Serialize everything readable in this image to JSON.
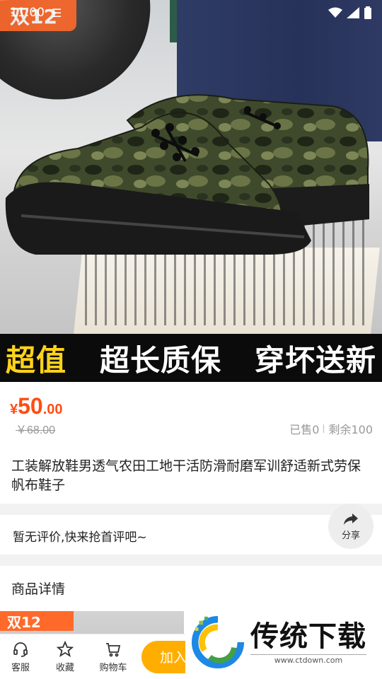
{
  "status_bar": {
    "time": "11:00",
    "menu_icon": "menu-lines-icon",
    "icons": [
      "wifi-icon",
      "signal-icon",
      "battery-icon"
    ]
  },
  "hero": {
    "promo_badge": "双12",
    "banner": {
      "left": "超值",
      "middle": "超长质保",
      "right": "穿坏送新"
    }
  },
  "price": {
    "symbol": "¥",
    "integer": "50",
    "decimal": ".00",
    "original": "￥68.00",
    "sold": "已售0",
    "remaining": "剩余100",
    "accent_color": "#ff4d12"
  },
  "product": {
    "title": "工装解放鞋男透气农田工地干活防滑耐磨军训舒适新式劳保帆布鞋子"
  },
  "review": {
    "empty_text": "暂无评价,快来抢首评吧~"
  },
  "share": {
    "label": "分享",
    "icon": "share-arrow-icon"
  },
  "details": {
    "title": "商品详情",
    "thumb_badge": "双12"
  },
  "bottom_bar": {
    "service": {
      "label": "客服",
      "icon": "headset-icon"
    },
    "favorite": {
      "label": "收藏",
      "icon": "star-icon"
    },
    "cart": {
      "label": "购物车",
      "icon": "cart-icon"
    },
    "add_to_cart": "加入",
    "button_color": "#ffae00"
  },
  "watermark": {
    "title": "传统下载",
    "url": "www.ctdown.com"
  }
}
